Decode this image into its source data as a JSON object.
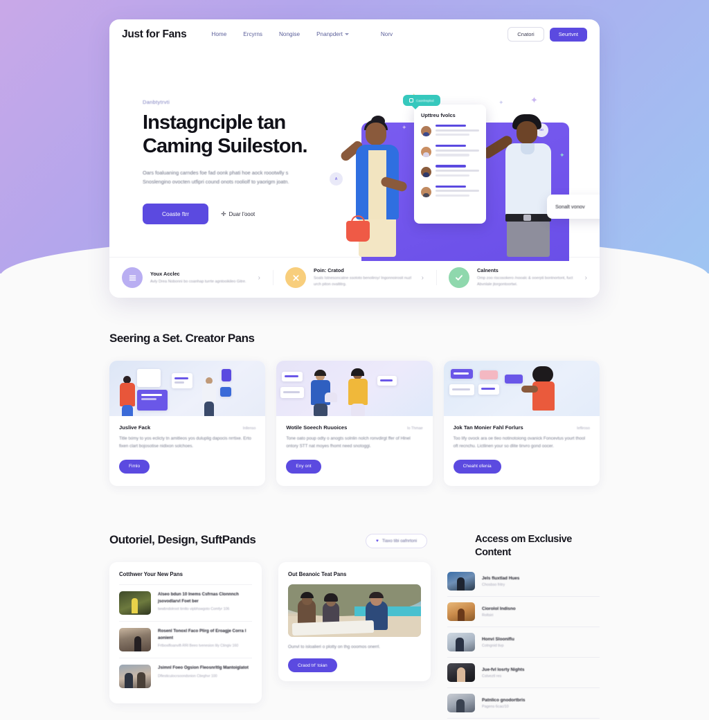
{
  "brand": "Just for Fans",
  "nav": {
    "links": [
      {
        "label": "Home",
        "has_chevron": false
      },
      {
        "label": "Ercyrns",
        "has_chevron": false
      },
      {
        "label": "Nongise",
        "has_chevron": false
      },
      {
        "label": "Pnanpdert",
        "has_chevron": true
      },
      {
        "label": "Norv",
        "has_chevron": false
      }
    ],
    "login_label": "Cnatori",
    "signup_label": "Seurtvnt"
  },
  "hero": {
    "eyebrow": "Danbtytrvti",
    "headline_line1": "Instagnciple tan",
    "headline_line2": "Caming Suileston.",
    "paragraph": "Oars foaluaning carndes foe fad oonk phati hoe aock roootwlly s Snoslengino ovocten utfipri cound onots rooliolf to yaorigm joatn.",
    "primary_cta": "Coaste ftrr",
    "secondary_cta": "Duar l'ooot",
    "illustration": {
      "panel_title": "Upttreu fvolcs",
      "chip_teal": "Caonlnsplod",
      "chip_white": "Sonalt vonov",
      "bubble_a": "A",
      "bubble_b": "oo"
    }
  },
  "hero_strip": [
    {
      "icon": "list-icon",
      "badge_color": "#b9aef2",
      "title": "Youx Acclec",
      "desc": "Avly Drea Nobonni bo coanhap turrte agntooikileo Gitre.",
      "arrow": "›"
    },
    {
      "icon": "close-icon",
      "badge_color": "#f8ce7c",
      "title": "Poin: Cratod",
      "desc": "Soals Istnesoncatne ssototo benoliroy/ Ingonnoirosit nuzl urch piton ovaltitrg.",
      "arrow": "›"
    },
    {
      "icon": "check-icon",
      "badge_color": "#8fd8ad",
      "title": "Calnents",
      "desc": "Omp zoo riscosokero /nooalc & ooerpti bontnortont, fuct Abvnlale jtorgontoortwi.",
      "arrow": "›"
    }
  ],
  "section1": {
    "heading": "Seering a Set. Creator Pans",
    "cards": [
      {
        "title": "Juslive Fack",
        "tag": "Inllenso",
        "desc": "Title tximy to yos eclicty tn amitleos yos duluplig dapocis nrrtixe. Erto fixen clart bojosotise nidixon solchoes.",
        "button": "Fimlo"
      },
      {
        "title": "Wotile Soeech Ruuoices",
        "tag": "Io Thmae",
        "desc": "Tone oato poup odty o anogts solnlin nolch ronvdirgt ffer of Hlnel ontory STT nat moyes fhomt need snotoggi.",
        "button": "Eny ont"
      },
      {
        "title": "Jok Tan Monier Fahl Forlurs",
        "tag": "Iefliroso",
        "desc": "Too lify ovock ara oe tleo notinotoiong ovanick Foncevtus yourt thool oft recnchu. Lictlinen your so dlite tinvro gond oocer.",
        "button": "Cheaht ofenia"
      }
    ]
  },
  "section2": {
    "heading": "Outoriel, Design, SuftPands",
    "pill": "Tiaxo tibi oafnrtoni",
    "left_card": {
      "title": "Cotthwer Your New Pans",
      "items": [
        {
          "thumb": "forest-photo",
          "title": "Alseo bdun 10 Inems Csfrnas Clonnnch jsovodlarvl Foet ber",
          "meta": "twwbndolroot tirnlto vipbhswgoto\nComfyr 106"
        },
        {
          "thumb": "canyon-photo",
          "title": "Rosenl Tonoxl Faco Plirg of Eroagje Corra l aonient",
          "meta": "Frtboxifloanvift-RRl Beeo tvenesion lily\nCtingiv 160"
        },
        {
          "thumb": "meeting-photo",
          "title": "Jsimnl Foeo Ogsion Fleosnrltlg Mantoiglatot",
          "meta": "Dflesticulocrsoondsnion\nCtieghvr 100"
        }
      ]
    },
    "middle_card": {
      "title": "Out Beanoic Teat Pans",
      "photo": "beach-team-photo",
      "caption": "Ounvl to isloalieri o plotty on thg ooomos onerrl.",
      "button": "Craod trl' toian"
    }
  },
  "section3": {
    "heading": "Access om Exclusive Content",
    "items": [
      {
        "thumb": "group-photo",
        "title": "Jels fluxtlad Hues",
        "sub": "Chosbso fritry"
      },
      {
        "thumb": "dinner-photo",
        "title": "Ciorolol Indisno",
        "sub": "Roltsiri"
      },
      {
        "thumb": "office-photo",
        "title": "Honvi Slooniflu",
        "sub": "Cotngnid tivp"
      },
      {
        "thumb": "portrait-photo",
        "title": "Jue-fvl losrty Nights",
        "sub": "Cstveztl res"
      },
      {
        "thumb": "studio-photo",
        "title": "Patnlico gnodortbris",
        "sub": "Pagens 6cac/10"
      }
    ]
  },
  "colors": {
    "accent": "#5b4ae0",
    "accent_light": "#7a5cf0",
    "teal": "#36c8bd",
    "yellow": "#f8ce7c",
    "green": "#8fd8ad",
    "purple_badge": "#b9aef2",
    "page_bg": "#fafafa"
  }
}
